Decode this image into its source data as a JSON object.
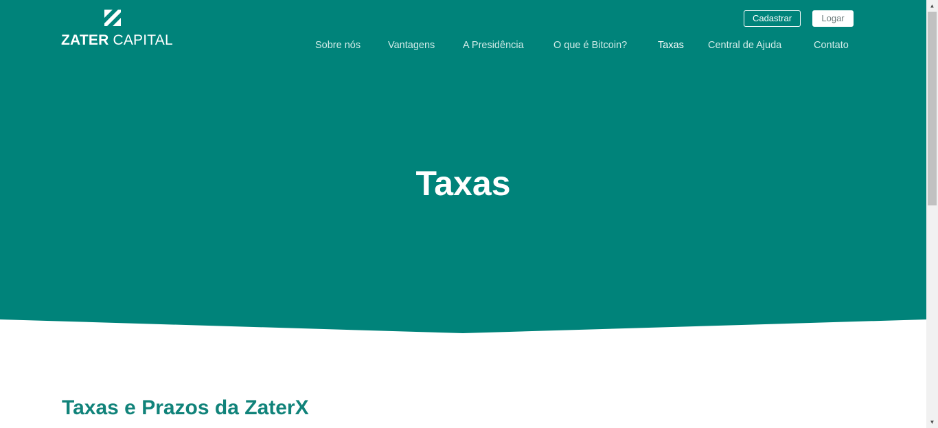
{
  "brand": {
    "name_bold": "ZATER",
    "name_light": " CAPITAL",
    "color_primary": "#00837a"
  },
  "header": {
    "register_label": "Cadastrar",
    "login_label": "Logar"
  },
  "nav": {
    "items": [
      {
        "label": "Sobre nós"
      },
      {
        "label": "Vantagens"
      },
      {
        "label": "A Presidência"
      },
      {
        "label": "O que é Bitcoin?"
      },
      {
        "label": "Taxas",
        "active": true
      },
      {
        "label": "Central de Ajuda"
      },
      {
        "label": "Contato"
      }
    ]
  },
  "hero": {
    "title": "Taxas"
  },
  "content": {
    "section_title": "Taxas e Prazos da ZaterX"
  },
  "icons": {
    "logo_mark": "zater-z-icon",
    "scroll_up": "arrow-up-icon",
    "scroll_down": "arrow-down-icon"
  }
}
